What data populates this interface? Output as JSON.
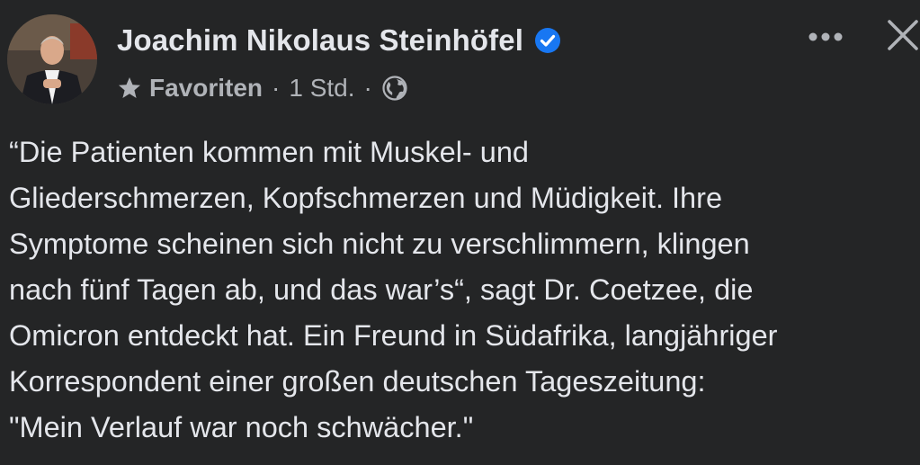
{
  "post": {
    "author_name": "Joachim Nikolaus Steinhöfel",
    "verified_icon": "verified-badge-icon",
    "meta": {
      "favorites_label": "Favoriten",
      "separator": "·",
      "time": "1 Std.",
      "audience_icon": "globe-icon"
    },
    "text_lines": [
      "“Die Patienten kommen mit Muskel- und",
      "Gliederschmerzen, Kopfschmerzen und Müdigkeit. Ihre",
      "Symptome scheinen sich nicht zu verschlimmern, klingen",
      "nach fünf Tagen ab, und das war’s“, sagt Dr. Coetzee, die",
      "Omicron entdeckt hat. Ein Freund in Südafrika, langjähriger",
      "Korrespondent einer großen deutschen Tageszeitung:",
      "\"Mein Verlauf war noch schwächer.\""
    ]
  },
  "colors": {
    "background": "#242526",
    "primary_text": "#e4e6eb",
    "secondary_text": "#b0b3b8",
    "verified_blue": "#1877f2"
  },
  "icons": {
    "more": "more-horizontal-icon",
    "close": "close-icon",
    "favorite": "star-icon"
  }
}
